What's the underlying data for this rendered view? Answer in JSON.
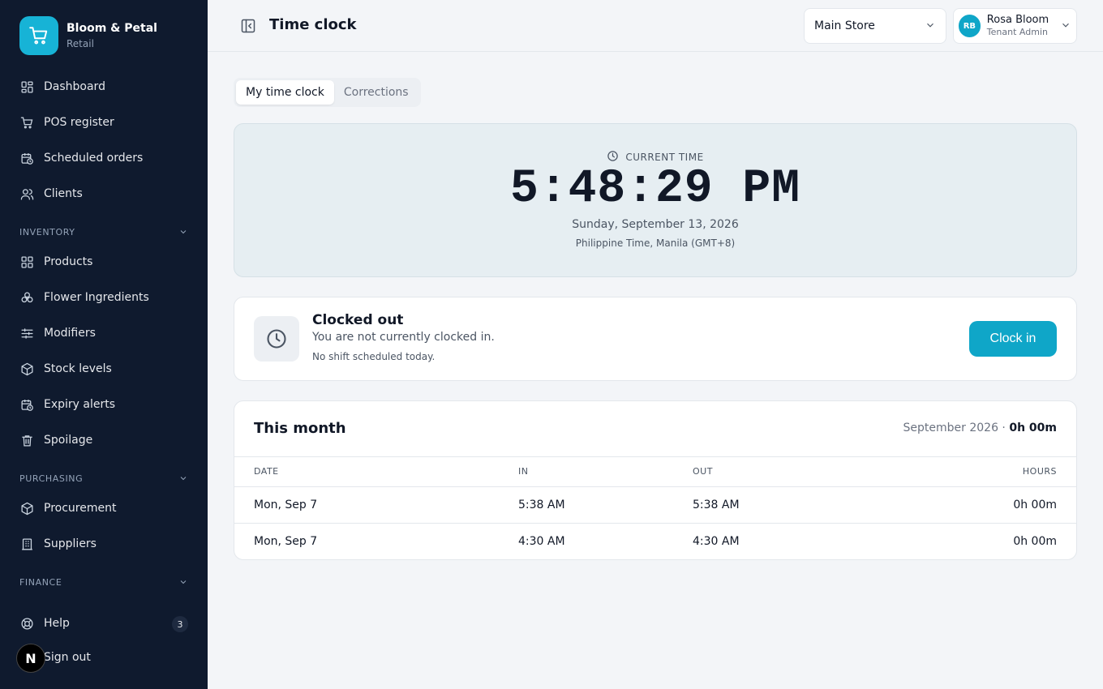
{
  "brand": {
    "name": "Bloom & Petal",
    "sub": "Retail"
  },
  "sidebar": {
    "items": [
      {
        "label": "Dashboard"
      },
      {
        "label": "POS register"
      },
      {
        "label": "Scheduled orders"
      },
      {
        "label": "Clients"
      }
    ],
    "inventory": {
      "title": "INVENTORY",
      "items": [
        {
          "label": "Products"
        },
        {
          "label": "Flower Ingredients"
        },
        {
          "label": "Modifiers"
        },
        {
          "label": "Stock levels"
        },
        {
          "label": "Expiry alerts"
        },
        {
          "label": "Spoilage"
        }
      ]
    },
    "purchasing": {
      "title": "PURCHASING",
      "items": [
        {
          "label": "Procurement"
        },
        {
          "label": "Suppliers"
        }
      ]
    },
    "finance": {
      "title": "FINANCE"
    },
    "help": {
      "label": "Help",
      "badge": "3"
    },
    "signout": {
      "label": "Sign out"
    },
    "bottom_avatar": "N"
  },
  "header": {
    "title": "Time clock",
    "store": "Main Store",
    "user": {
      "initials": "RB",
      "name": "Rosa Bloom",
      "role": "Tenant Admin"
    }
  },
  "tabs": [
    {
      "label": "My time clock",
      "active": true
    },
    {
      "label": "Corrections",
      "active": false
    }
  ],
  "clock": {
    "label": "CURRENT TIME",
    "time": "5:48:29 PM",
    "date": "Sunday, September 13, 2026",
    "timezone": "Philippine Time, Manila (GMT+8)"
  },
  "status": {
    "title": "Clocked out",
    "subtitle": "You are not currently clocked in.",
    "note": "No shift scheduled today.",
    "button": "Clock in"
  },
  "month": {
    "title": "This month",
    "period": "September 2026 ·",
    "total": "0h 00m",
    "columns": {
      "date": "DATE",
      "in": "IN",
      "out": "OUT",
      "hours": "HOURS"
    },
    "rows": [
      {
        "date": "Mon, Sep 7",
        "in": "5:38 AM",
        "out": "5:38 AM",
        "hours": "0h 00m"
      },
      {
        "date": "Mon, Sep 7",
        "in": "4:30 AM",
        "out": "4:30 AM",
        "hours": "0h 00m"
      }
    ]
  },
  "colors": {
    "accent": "#0fa6c8",
    "sidebar": "#0f1a2e",
    "clock_bg": "#e6eef2"
  }
}
